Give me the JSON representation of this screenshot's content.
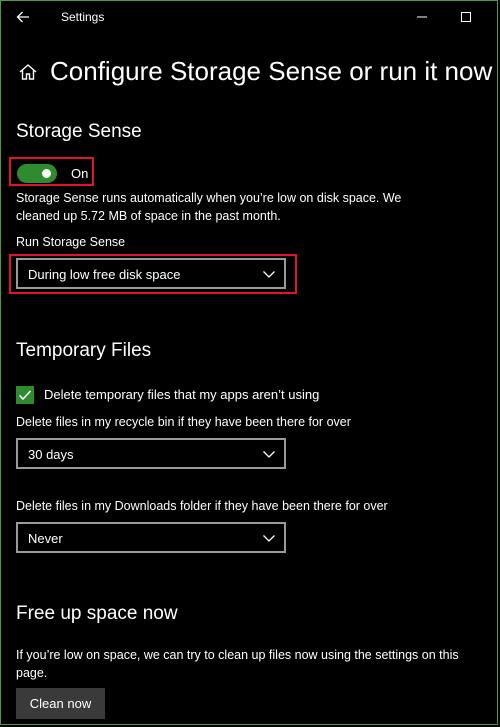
{
  "window": {
    "title": "Settings"
  },
  "page": {
    "title": "Configure Storage Sense or run it now"
  },
  "storage_sense": {
    "heading": "Storage Sense",
    "toggle_state": "On",
    "toggle_on": true,
    "description_line1": "Storage Sense runs automatically when you’re low on disk space. We",
    "description_line2": "cleaned up 5.72 MB of space in the past month.",
    "run_label": "Run Storage Sense",
    "run_value": "During low free disk space"
  },
  "temporary_files": {
    "heading": "Temporary Files",
    "delete_temp_label": "Delete temporary files that my apps aren’t using",
    "delete_temp_checked": true,
    "recycle_label": "Delete files in my recycle bin if they have been there for over",
    "recycle_value": "30 days",
    "downloads_label": "Delete files in my Downloads folder if they have been there for over",
    "downloads_value": "Never"
  },
  "free_up": {
    "heading": "Free up space now",
    "description_line1": "If you’re low on space, we can try to clean up files now using the settings on this",
    "description_line2": "page.",
    "button_label": "Clean now"
  },
  "colors": {
    "accent_green": "#2e8b2e",
    "highlight_red": "#e0142c",
    "background": "#000000"
  },
  "icons": [
    "back-arrow-icon",
    "minimize-icon",
    "maximize-icon",
    "home-icon",
    "chevron-down-icon",
    "checkmark-icon"
  ]
}
